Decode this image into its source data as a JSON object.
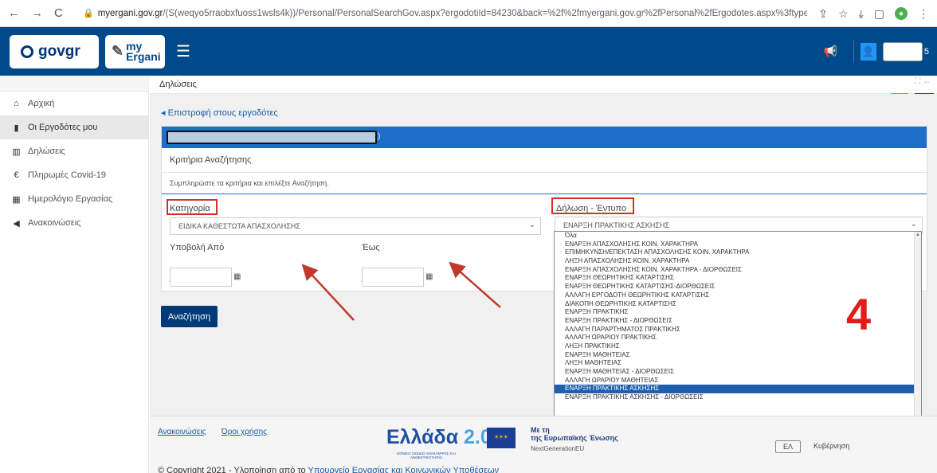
{
  "browser": {
    "url_host": "myergani.gov.gr",
    "url_path": "/(S(weqyo5rraobxfuoss1wsls4k))/Personal/PersonalSearchGov.aspx?ergodotiId=84230&back=%2f%2fmyergani.gov.gr%2fPersonal%2fErgodotes.aspx%3ftype%3dspecial",
    "back_icon": "←",
    "forward_icon": "→",
    "reload_icon": "C",
    "lock_icon": "🔒",
    "share_icon": "⇪",
    "star_icon": "☆",
    "download_icon": "⤓",
    "window_icon": "▢",
    "menu_icon": "⋮"
  },
  "header": {
    "govgr_label": "govgr",
    "my_label": "my",
    "ergani_label": "Ergani",
    "burger_icon": "☰",
    "megaphone_icon": "📢",
    "user_suffix": "5"
  },
  "sidebar": {
    "items": [
      {
        "icon": "⌂",
        "label": "Αρχική"
      },
      {
        "icon": "▮",
        "label": "Οι Εργοδότες μου"
      },
      {
        "icon": "▥",
        "label": "Δηλώσεις"
      },
      {
        "icon": "€",
        "label": "Πληρωμές Covid-19"
      },
      {
        "icon": "▦",
        "label": "Ημερολόγιο Εργασίας"
      },
      {
        "icon": "◀",
        "label": "Ανακοινώσεις"
      }
    ]
  },
  "breadcrumb": {
    "label": "Δηλώσεις",
    "tab_icons": "⛶  ↔"
  },
  "main": {
    "back_link": "◂ Επιστροφή στους εργοδότες",
    "panel_header_suffix": ")",
    "criteria_title": "Κριτήρια Αναζήτησης",
    "criteria_hint": "Συμπληρώστε τα κριτήρια και επιλέξτε Αναζήτηση.",
    "category_label": "Κατηγορία",
    "category_value": "ΕΙΔΙΚΑ ΚΑΘΕΣΤΩΤΑ ΑΠΑΣΧΟΛΗΣΗΣ",
    "form_label": "Δήλωση - Έντυπο",
    "form_value": "ΕΝΑΡΞΗ ΠΡΑΚΤΙΚΗΣ ΑΣΚΗΣΗΣ",
    "from_label": "Υποβολή Από",
    "to_label": "Έως",
    "calendar_icon": "▦",
    "search_button": "Αναζήτηση",
    "chevron": "⌄"
  },
  "dropdown": {
    "options": [
      "Όλα",
      "ΕΝΑΡΞΗ ΑΠΑΣΧΟΛΗΣΗΣ ΚΟΙΝ. ΧΑΡΑΚΤΗΡΑ",
      "ΕΠΙΜΗΚΥΝΣΗ/ΕΠΕΚΤΑΣΗ ΑΠΑΣΧΟΛΗΣΗΣ ΚΟΙΝ. ΧΑΡΑΚΤΗΡΑ",
      "ΛΗΞΗ ΑΠΑΣΧΟΛΗΣΗΣ ΚΟΙΝ. ΧΑΡΑΚΤΗΡΑ",
      "ΕΝΑΡΞΗ ΑΠΑΣΧΟΛΗΣΗΣ ΚΟΙΝ. ΧΑΡΑΚΤΗΡΑ - ΔΙΟΡΘΩΣΕΙΣ",
      "ΕΝΑΡΞΗ ΘΕΩΡΗΤΙΚΗΣ ΚΑΤΑΡΤΙΣΗΣ",
      "ΕΝΑΡΞΗ ΘΕΩΡΗΤΙΚΗΣ ΚΑΤΑΡΤΙΣΗΣ-ΔΙΟΡΘΩΣΕΙΣ",
      "ΑΛΛΑΓΗ ΕΡΓΟΔΟΤΗ ΘΕΩΡΗΤΙΚΗΣ ΚΑΤΑΡΤΙΣΗΣ",
      "ΔΙΑΚΟΠΗ ΘΕΩΡΗΤΙΚΗΣ ΚΑΤΑΡΤΙΣΗΣ",
      "ΕΝΑΡΞΗ ΠΡΑΚΤΙΚΗΣ",
      "ΕΝΑΡΞΗ ΠΡΑΚΤΙΚΗΣ - ΔΙΟΡΘΩΣΕΙΣ",
      "ΑΛΛΑΓΗ ΠΑΡΑΡΤΗΜΑΤΟΣ ΠΡΑΚΤΙΚΗΣ",
      "ΑΛΛΑΓΗ ΩΡΑΡΙΟΥ ΠΡΑΚΤΙΚΗΣ",
      "ΛΗΞΗ ΠΡΑΚΤΙΚΗΣ",
      "ΕΝΑΡΞΗ ΜΑΘΗΤΕΙΑΣ",
      "ΛΗΞΗ ΜΑΘΗΤΕΙΑΣ",
      "ΕΝΑΡΞΗ ΜΑΘΗΤΕΙΑΣ - ΔΙΟΡΘΩΣΕΙΣ",
      "ΑΛΛΑΓΗ ΩΡΑΡΙΟΥ ΜΑΘΗΤΕΙΑΣ",
      "ΕΝΑΡΞΗ ΠΡΑΚΤΙΚΗΣ ΑΣΚΗΣΗΣ",
      "ΕΝΑΡΞΗ ΠΡΑΚΤΙΚΗΣ ΑΣΚΗΣΗΣ - ΔΙΟΡΘΩΣΕΙΣ"
    ],
    "selected_index": 18,
    "scroll_up": "▲",
    "scroll_down": "▼"
  },
  "annotation": {
    "number": "4",
    "color": "#e21b1b",
    "arrow_color": "#c0392b"
  },
  "footer": {
    "link_announcements": "Ανακοινώσεις",
    "link_terms": "Όροι χρήσης",
    "ellada": "Ελλάδα",
    "ellada_two": "2.0",
    "ellada_sub": "ΕΘΝΙΚΟ ΣΧΕΔΙΟ ΑΝΑΚΑΜΨΗΣ ΚΑΙ ΑΝΘΕΚΤΙΚΟΤΗΤΑΣ",
    "eu_text_1": "Με τη",
    "eu_text_2": "της Ευρωπαϊκής Ένωσης",
    "eu_sub": "NextGenerationEU",
    "gov_label": "Κυβέρνηση",
    "copyright_prefix": "© Copyright 2021 - Υλοποίηση από το",
    "copyright_link": "Υπουργείο Εργασίας και Κοινωνικών Υποθέσεων"
  },
  "colors": {
    "header_bg": "#004a8c",
    "panel_header": "#1c6ec9",
    "selected_option": "#1e5fb0",
    "search_button": "#003a77"
  }
}
